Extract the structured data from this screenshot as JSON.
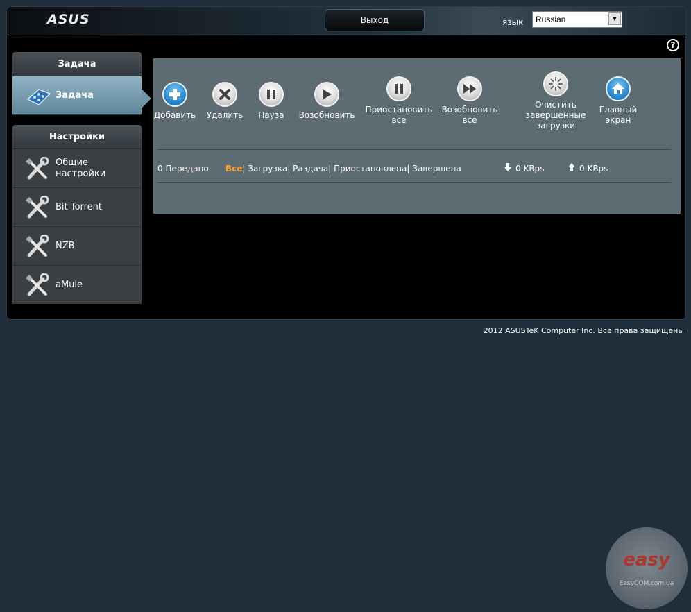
{
  "header": {
    "brand": "ASUS",
    "logout_label": "Выход",
    "language_label": "язык",
    "language_value": "Russian",
    "help_symbol": "?"
  },
  "sidebar": {
    "tasks_panel": {
      "title": "Задача",
      "items": [
        {
          "label": "Задача",
          "icon": "task-icon",
          "active": true
        }
      ]
    },
    "settings_panel": {
      "title": "Настройки",
      "items": [
        {
          "label_line1": "Общие",
          "label_line2": "настройки",
          "icon": "wrench-icon"
        },
        {
          "label": "Bit Torrent",
          "icon": "wrench-icon"
        },
        {
          "label": "NZB",
          "icon": "wrench-icon"
        },
        {
          "label": "aMule",
          "icon": "wrench-icon"
        }
      ]
    }
  },
  "toolbar": {
    "add": {
      "label": "Добавить",
      "icon": "plus-icon"
    },
    "delete": {
      "label": "Удалить",
      "icon": "x-icon"
    },
    "pause": {
      "label": "Пауза",
      "icon": "pause-icon"
    },
    "resume": {
      "label": "Возобновить",
      "icon": "play-icon"
    },
    "pause_all": {
      "line1": "Приостановить",
      "line2": "все",
      "icon": "pause-icon"
    },
    "resume_all": {
      "line1": "Возобновить",
      "line2": "все",
      "icon": "fast-forward-icon"
    },
    "clear_done": {
      "line1": "Очистить",
      "line2": "завершенные",
      "line3": "загрузки",
      "icon": "spinner-icon"
    },
    "home": {
      "line1": "Главный",
      "line2": "экран",
      "icon": "home-icon"
    }
  },
  "status": {
    "transferred": "0 Передано",
    "filters": {
      "all": "Все",
      "download": "| Загрузка",
      "seed": "| Раздача",
      "paused": "| Приостановлена",
      "done": "| Завершена"
    },
    "download_speed": "0 KBps",
    "upload_speed": "0 KBps"
  },
  "footer": {
    "copyright": "2012 ASUSTeK Computer Inc. Все права защищены"
  },
  "watermark": {
    "logo_text": "easy",
    "site": "EasyCOM.com.ua"
  },
  "colors": {
    "accent_orange": "#ff9f1c",
    "content_bg": "#5d6c73",
    "page_bg": "#1f2e3a"
  }
}
